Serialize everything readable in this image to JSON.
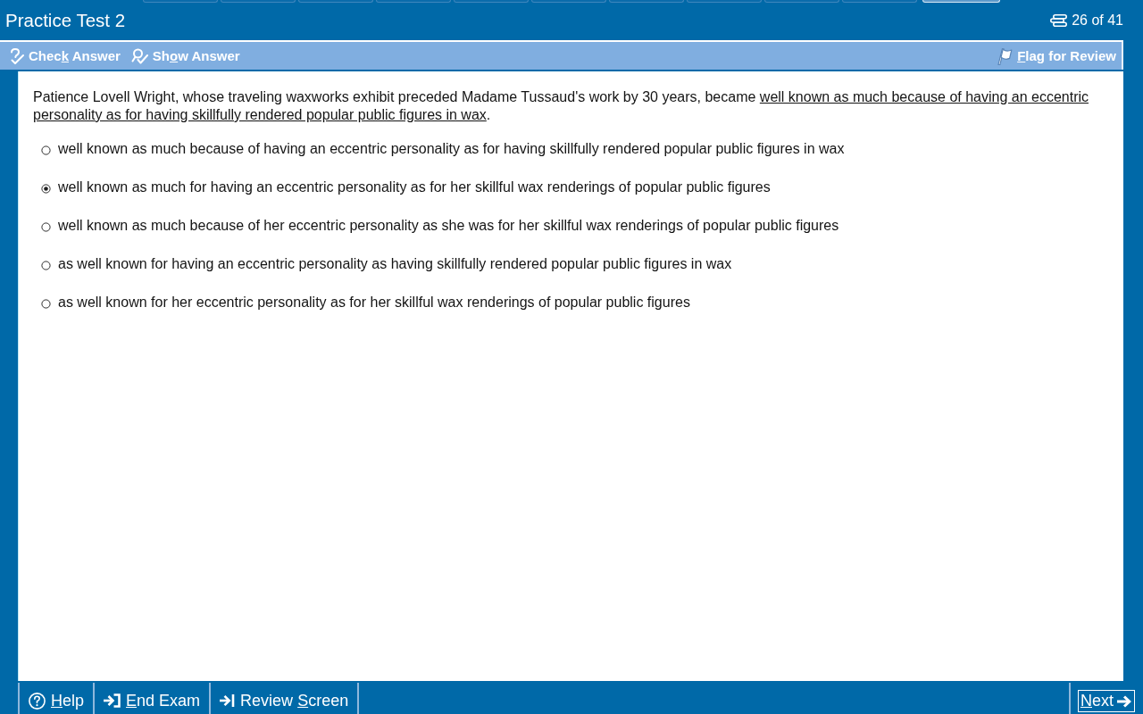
{
  "window": {
    "title": "Practice Test 2"
  },
  "top_tabs": [
    {
      "selected": false
    },
    {
      "selected": false
    },
    {
      "selected": false
    },
    {
      "selected": false
    },
    {
      "selected": false
    },
    {
      "selected": false
    },
    {
      "selected": false
    },
    {
      "selected": false
    },
    {
      "selected": false
    },
    {
      "selected": false
    },
    {
      "selected": true
    }
  ],
  "counter": {
    "text": "26 of 41"
  },
  "toolbar": {
    "left": [
      {
        "kind": "check",
        "label": [
          {
            "text": "Chec",
            "underlined": false
          },
          {
            "text": "k",
            "underlined": true
          },
          {
            "text": " Answer",
            "underlined": false
          }
        ]
      },
      {
        "kind": "show",
        "label": [
          {
            "text": "Sh",
            "underlined": false
          },
          {
            "text": "o",
            "underlined": true
          },
          {
            "text": "w Answer",
            "underlined": false
          }
        ]
      }
    ],
    "right": [
      {
        "kind": "flag",
        "label": [
          {
            "text": "F",
            "underlined": true
          },
          {
            "text": "lag for Review",
            "underlined": false
          }
        ]
      }
    ]
  },
  "question": {
    "stem_before": "Patience Lovell Wright, whose traveling waxworks exhibit preceded Madame Tussaud's work by 30 years, became ",
    "stem_underlined": "well known as much because of having an eccentric personality as for having skillfully rendered popular public figures in wax",
    "stem_after": "."
  },
  "options": [
    {
      "text": "well known as much because of having an eccentric personality as for having skillfully rendered popular public figures in wax",
      "selected": false
    },
    {
      "text": "well known as much for having an eccentric personality as for her skillful wax renderings of popular public figures",
      "selected": true
    },
    {
      "text": "well known as much because of her eccentric personality as she was for her skillful wax renderings of popular public figures",
      "selected": false
    },
    {
      "text": "as well known for having an eccentric personality as having skillfully rendered popular public figures in wax",
      "selected": false
    },
    {
      "text": "as well known for her eccentric personality as for her skillful wax renderings of popular public figures",
      "selected": false
    }
  ],
  "footer": {
    "left": [
      {
        "kind": "help",
        "label": [
          {
            "text": "H",
            "underlined": true
          },
          {
            "text": "elp",
            "underlined": false
          }
        ]
      },
      {
        "kind": "end",
        "label": [
          {
            "text": "E",
            "underlined": true
          },
          {
            "text": "nd Exam",
            "underlined": false
          }
        ]
      },
      {
        "kind": "review",
        "label": [
          {
            "text": "Review ",
            "underlined": false
          },
          {
            "text": "S",
            "underlined": true
          },
          {
            "text": "creen",
            "underlined": false
          }
        ]
      }
    ],
    "right": [
      {
        "kind": "next",
        "label": [
          {
            "text": "N",
            "underlined": true
          },
          {
            "text": "ext",
            "underlined": false
          }
        ]
      }
    ]
  }
}
